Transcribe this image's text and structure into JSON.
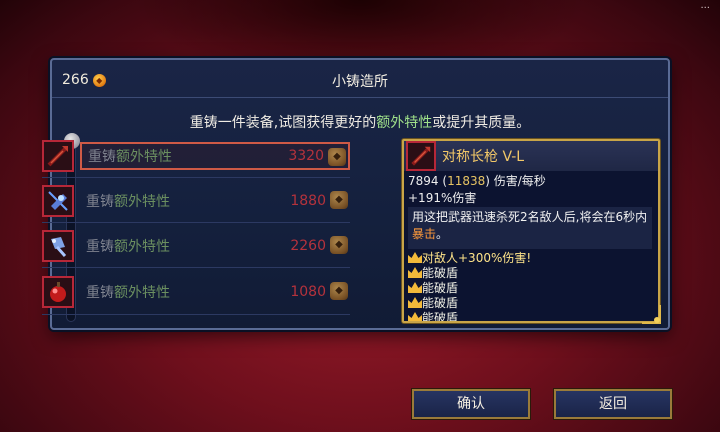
{
  "top_status": "...",
  "header": {
    "currency_amount": "266",
    "title": "小铸造所"
  },
  "instruction": {
    "pre": "重铸一件装备,试图获得更好的",
    "highlight": "额外特性",
    "post": "或提升其质量。"
  },
  "rows": [
    {
      "label_a": "重铸",
      "label_b": "额外特性",
      "price": "3320",
      "icon": "spear-icon"
    },
    {
      "label_a": "重铸",
      "label_b": "额外特性",
      "price": "1880",
      "icon": "crossbow-icon"
    },
    {
      "label_a": "重铸",
      "label_b": "额外特性",
      "price": "2260",
      "icon": "grenade-icon"
    },
    {
      "label_a": "重铸",
      "label_b": "额外特性",
      "price": "1080",
      "icon": "bomb-icon"
    }
  ],
  "tooltip": {
    "name": "对称长枪 V-L",
    "dps_value": "7894",
    "dps_paren_open": "(",
    "dps_alt": "11838",
    "dps_paren_close": ")",
    "dps_unit": "伤害/每秒",
    "bonus": "+191%伤害",
    "desc_pre": "用这把武器迅速杀死2名敌人后,将会在6秒内",
    "desc_crit": "暴击",
    "desc_post": "。",
    "affixes": [
      "对敌人+300%伤害!",
      "能破盾",
      "能破盾",
      "能破盾",
      "能破盾"
    ]
  },
  "buttons": {
    "confirm": "确认",
    "back": "返回"
  },
  "colors": {
    "gold_text": "#f2c868",
    "price_red": "#b4323c",
    "highlight_green": "#9fe08a",
    "crit_orange": "#ff9a3a"
  }
}
